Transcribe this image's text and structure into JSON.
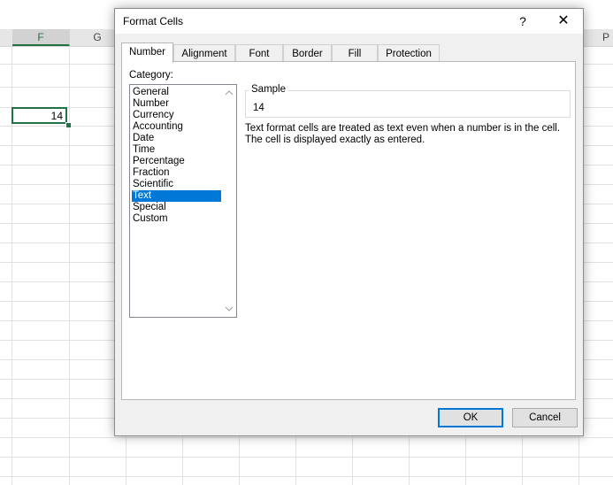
{
  "sheet": {
    "columns": [
      {
        "label": "F",
        "selected": true
      },
      {
        "label": "G",
        "selected": false
      },
      {
        "label": "P",
        "selected": false
      }
    ],
    "active_cell_value": "14",
    "accent_color": "#217346"
  },
  "dialog": {
    "title": "Format Cells",
    "help_label": "?",
    "close_label": "✕",
    "tabs": [
      "Number",
      "Alignment",
      "Font",
      "Border",
      "Fill",
      "Protection"
    ],
    "active_tab": "Number",
    "category_label": "Category:",
    "categories": [
      "General",
      "Number",
      "Currency",
      "Accounting",
      "Date",
      "Time",
      "Percentage",
      "Fraction",
      "Scientific",
      "Text",
      "Special",
      "Custom"
    ],
    "selected_category": "Text",
    "sample_label": "Sample",
    "sample_value": "14",
    "description": "Text format cells are treated as text even when a number is in the cell. The cell is displayed exactly as entered.",
    "ok_label": "OK",
    "cancel_label": "Cancel",
    "selection_color": "#0078d7"
  }
}
